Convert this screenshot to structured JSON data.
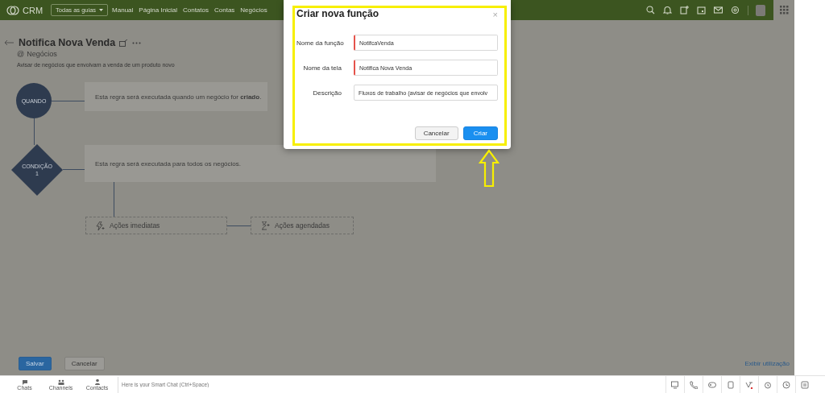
{
  "nav": {
    "logo": "CRM",
    "all_tabs": "Todas as guias",
    "items": [
      "Manual",
      "Página Inicial",
      "Contatos",
      "Contas",
      "Negócios"
    ]
  },
  "rule": {
    "title": "Notifica Nova Venda",
    "module_prefix": "@",
    "module": "Negócios",
    "description": "Avisar de negócios que envolvam a venda de um produto novo"
  },
  "flow": {
    "trigger_node": "QUANDO",
    "trigger_text": "Esta regra será executada quando um negócio for **criado**.",
    "condition_node": [
      "CONDIÇÃO",
      "1"
    ],
    "condition_text": "Esta regra será executada para todos os negócios.",
    "actions": [
      {
        "kind": "immediate",
        "label": "Ações imediatas"
      },
      {
        "kind": "scheduled",
        "label": "Ações agendadas"
      }
    ]
  },
  "footer": {
    "save": "Salvar",
    "cancel": "Cancelar",
    "usage_link": "Exibir utilização"
  },
  "chat_bar": {
    "tabs": [
      "Chats",
      "Channels",
      "Contacts"
    ],
    "placeholder": "Here is your Smart Chat (Ctrl+Space)"
  },
  "dialog": {
    "title": "Criar nova função",
    "close": "×",
    "fields": [
      {
        "label": "Nome da função",
        "value": "NotifcaVenda",
        "required": true
      },
      {
        "label": "Nome da tela",
        "value": "Notifica Nova Venda",
        "required": true
      },
      {
        "label": "Descrição",
        "value": "Fluxos de trabalho (avisar de negócios que envolv",
        "required": false
      }
    ],
    "cancel": "Cancelar",
    "create": "Criar"
  }
}
